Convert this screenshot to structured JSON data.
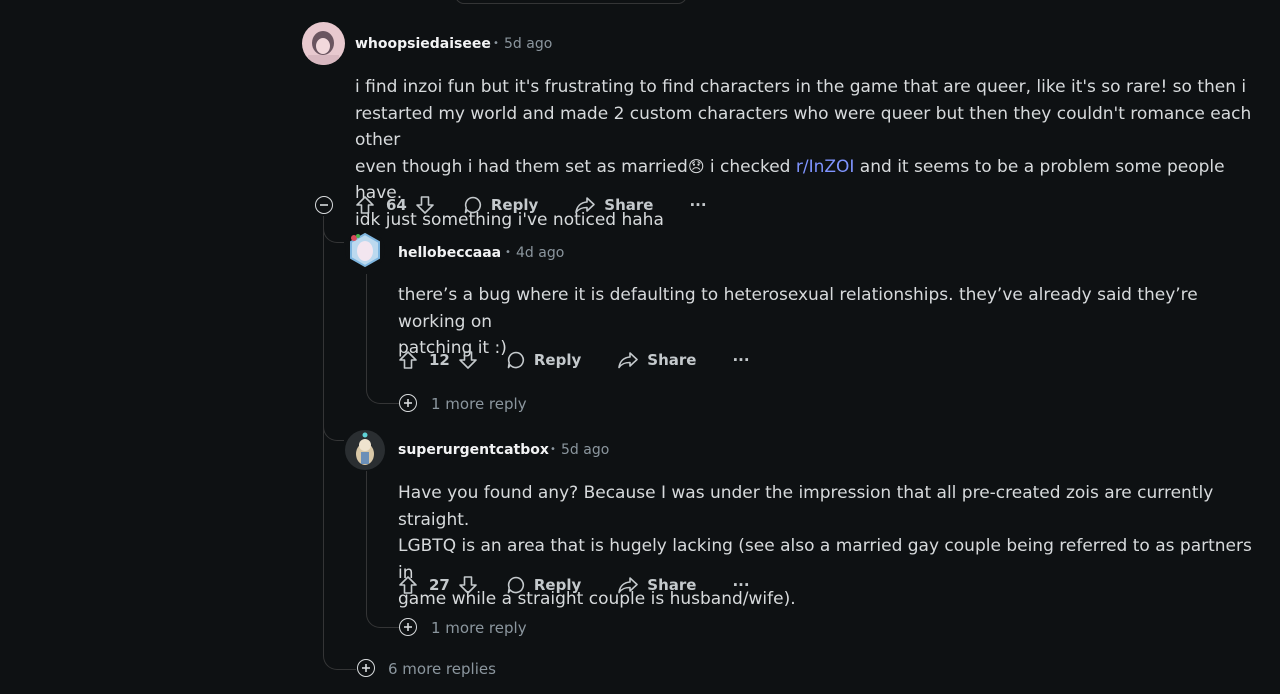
{
  "comments": [
    {
      "username": "whoopsiedaiseee",
      "age": "5d ago",
      "body_lines": [
        "i find inzoi fun but it's frustrating to find characters in the game that are queer, like it's so rare! so then i",
        "restarted my world and made 2 custom characters who were queer but then they couldn't romance each other",
        "idk just something i've noticed haha"
      ],
      "line3_before": "even though i had them set as married",
      "line3_emoji": "😞",
      "line3_mid": " i checked ",
      "line3_link": "r/InZOI",
      "line3_after": " and it seems to be a problem some people have.",
      "votes": "64",
      "reply_label": "Reply",
      "share_label": "Share",
      "more_label": "···"
    },
    {
      "username": "hellobeccaaa",
      "age": "4d ago",
      "body_lines": [
        "there’s a bug where it is defaulting to heterosexual relationships. they’ve already said they’re working on",
        "patching it :)"
      ],
      "votes": "12",
      "reply_label": "Reply",
      "share_label": "Share",
      "more_label": "···",
      "more_replies": "1 more reply"
    },
    {
      "username": "superurgentcatbox",
      "age": "5d ago",
      "body_lines": [
        "Have you found any? Because I was under the impression that all pre-created zois are currently straight.",
        "LGBTQ is an area that is hugely lacking (see also a married gay couple being referred to as partners in",
        "game while a straight couple is husband/wife)."
      ],
      "votes": "27",
      "reply_label": "Reply",
      "share_label": "Share",
      "more_label": "···",
      "more_replies": "1 more reply"
    }
  ],
  "thread_more_replies": "6 more replies",
  "separator": "•",
  "icons": {
    "upvote": "arrow-up-outline",
    "downvote": "arrow-down-outline",
    "reply": "speech-bubble-outline",
    "share": "share-arrow-outline",
    "collapse": "minus-circle",
    "expand": "plus-circle"
  }
}
